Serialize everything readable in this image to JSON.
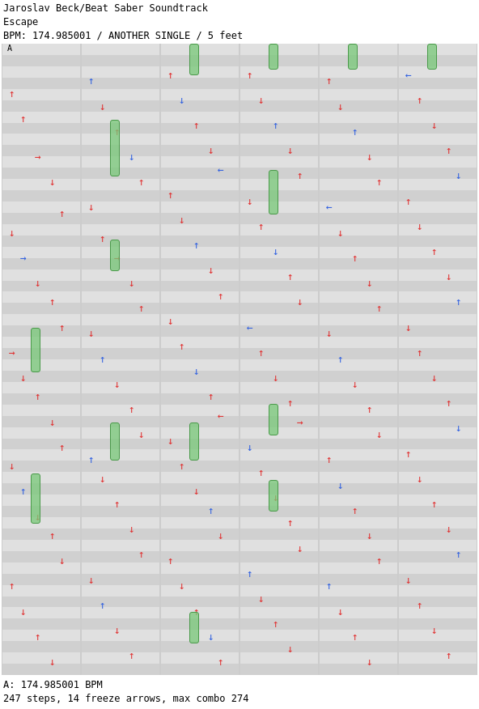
{
  "header": {
    "title": "Jaroslav Beck/Beat Saber Soundtrack",
    "song": "Escape",
    "bpm_line": "BPM: 174.985001 / ANOTHER SINGLE / 5 feet",
    "lane_label": "A"
  },
  "footer": {
    "bpm_note": "A: 174.985001 BPM",
    "stats": "247 steps, 14 freeze arrows, max combo 274"
  },
  "colors": {
    "red": "#e03030",
    "blue": "#3060e0",
    "green_freeze": "#80c880"
  }
}
